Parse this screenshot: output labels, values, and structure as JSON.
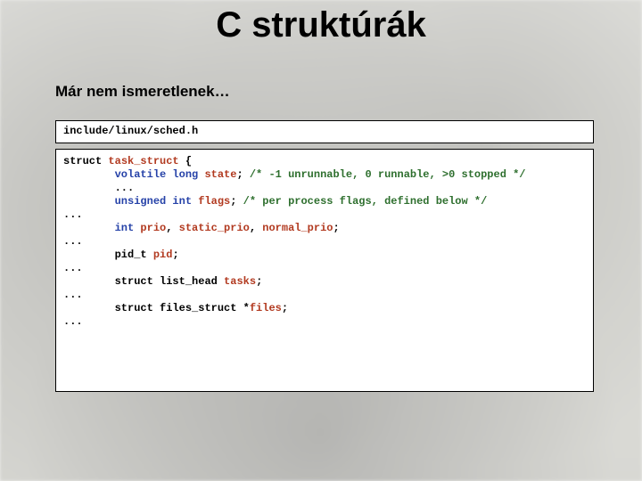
{
  "title": "C struktúrák",
  "subtitle": "Már nem ismeretlenek…",
  "filepath": "include/linux/sched.h",
  "code": {
    "l1a": "struct",
    "l1b": "task_struct",
    "l1c": " {",
    "l2a": "        ",
    "l2b": "volatile",
    "l2c": " ",
    "l2d": "long",
    "l2e": " ",
    "l2f": "state",
    "l2g": "; ",
    "l2h": "/* -1 unrunnable, 0 runnable, >0 stopped */",
    "l3": "        ...",
    "l4a": "        ",
    "l4b": "unsigned",
    "l4c": " ",
    "l4d": "int",
    "l4e": " ",
    "l4f": "flags",
    "l4g": "; ",
    "l4h": "/* per process flags, defined below */",
    "l5": "...",
    "l6a": "        ",
    "l6b": "int",
    "l6c": " ",
    "l6d": "prio",
    "l6e": ", ",
    "l6f": "static_prio",
    "l6g": ", ",
    "l6h": "normal_prio",
    "l6i": ";",
    "l7": "...",
    "l8a": "        pid_t ",
    "l8b": "pid",
    "l8c": ";",
    "l9": "...",
    "l10a": "        ",
    "l10b": "struct",
    "l10c": " list_head ",
    "l10d": "tasks",
    "l10e": ";",
    "l11": "...",
    "l12a": "        ",
    "l12b": "struct",
    "l12c": " files_struct *",
    "l12d": "files",
    "l12e": ";",
    "l13": "..."
  }
}
